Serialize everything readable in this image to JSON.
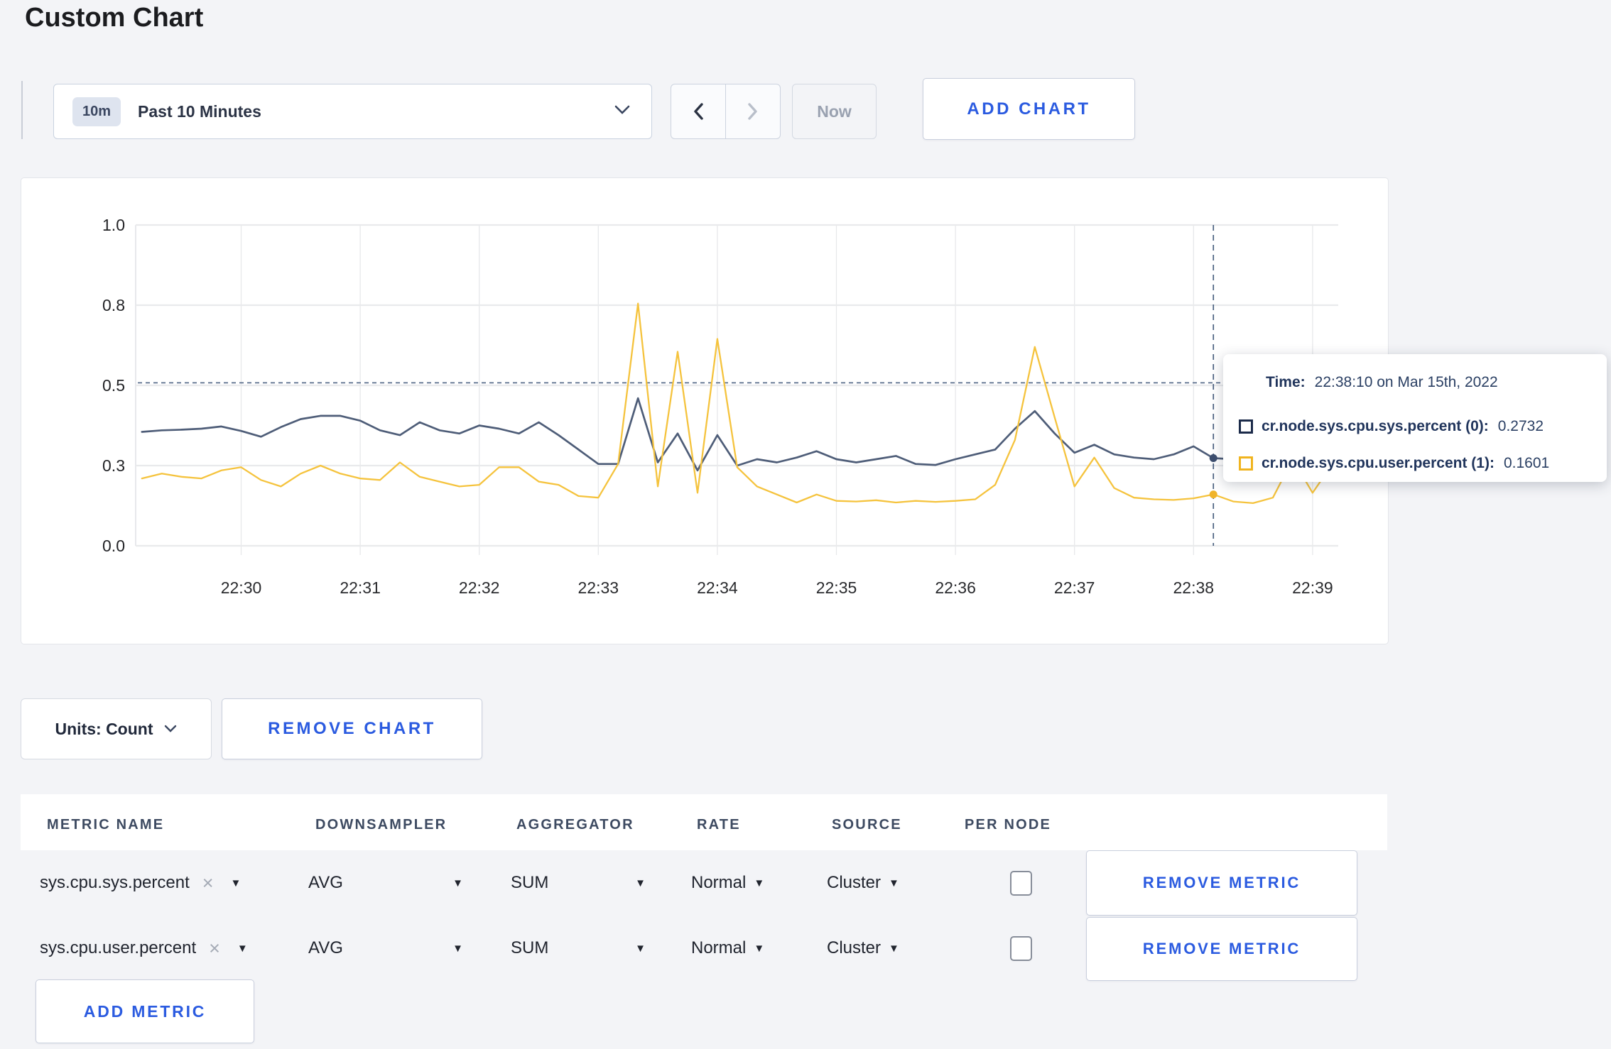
{
  "page": {
    "title": "Custom Chart"
  },
  "colors": {
    "accent_blue": "#2b5be0",
    "series_sys": "#4e5d78",
    "series_user": "#f5c33d",
    "tooltip_sys_square": "#1c2b4a",
    "tooltip_user_square": "#f0b41f"
  },
  "toolbar": {
    "time_window_badge": "10m",
    "time_window_label": "Past 10 Minutes",
    "now_label": "Now",
    "add_chart_label": "ADD CHART"
  },
  "chart_controls": {
    "units_label": "Units: Count",
    "remove_chart_label": "REMOVE CHART"
  },
  "tooltip": {
    "time_label": "Time:",
    "time_value": "22:38:10 on Mar 15th, 2022",
    "rows": [
      {
        "name": "cr.node.sys.cpu.sys.percent (0):",
        "value": "0.2732"
      },
      {
        "name": "cr.node.sys.cpu.user.percent (1):",
        "value": "0.1601"
      }
    ]
  },
  "chart_data": {
    "type": "line",
    "title": "",
    "xlabel": "",
    "ylabel": "",
    "grid": true,
    "legend_position": "tooltip",
    "ylim": [
      0,
      1.0
    ],
    "y_tick_labels": [
      "0.0",
      "0.3",
      "0.5",
      "0.8",
      "1.0"
    ],
    "y_tick_values": [
      0,
      0.25,
      0.5,
      0.75,
      1.0
    ],
    "x_tick_labels": [
      "22:30",
      "22:31",
      "22:32",
      "22:33",
      "22:34",
      "22:35",
      "22:36",
      "22:37",
      "22:38",
      "22:39"
    ],
    "x_start": "22:29:10",
    "x_interval_seconds": 10,
    "guide_hline_value": 0.508,
    "crosshair": {
      "time": "22:38:10",
      "index": 54,
      "sys_value": 0.2732,
      "user_value": 0.1601
    },
    "series": [
      {
        "name": "cr.node.sys.cpu.sys.percent (0)",
        "color": "#4e5d78",
        "values": [
          0.355,
          0.36,
          0.362,
          0.365,
          0.372,
          0.358,
          0.34,
          0.37,
          0.395,
          0.405,
          0.405,
          0.39,
          0.36,
          0.345,
          0.385,
          0.36,
          0.35,
          0.375,
          0.365,
          0.35,
          0.385,
          0.345,
          0.3,
          0.255,
          0.255,
          0.46,
          0.26,
          0.35,
          0.235,
          0.345,
          0.25,
          0.27,
          0.26,
          0.275,
          0.295,
          0.27,
          0.26,
          0.27,
          0.28,
          0.255,
          0.252,
          0.27,
          0.285,
          0.3,
          0.365,
          0.42,
          0.35,
          0.29,
          0.315,
          0.285,
          0.275,
          0.27,
          0.285,
          0.31,
          0.2732,
          0.27,
          0.285,
          0.295,
          0.28,
          0.29,
          0.305
        ]
      },
      {
        "name": "cr.node.sys.cpu.user.percent (1)",
        "color": "#f5c33d",
        "values": [
          0.21,
          0.225,
          0.215,
          0.21,
          0.235,
          0.245,
          0.205,
          0.185,
          0.225,
          0.25,
          0.225,
          0.21,
          0.205,
          0.26,
          0.215,
          0.2,
          0.185,
          0.19,
          0.245,
          0.245,
          0.2,
          0.19,
          0.155,
          0.15,
          0.255,
          0.755,
          0.185,
          0.605,
          0.165,
          0.645,
          0.245,
          0.185,
          0.16,
          0.135,
          0.16,
          0.14,
          0.138,
          0.142,
          0.135,
          0.14,
          0.137,
          0.14,
          0.145,
          0.19,
          0.33,
          0.62,
          0.4,
          0.185,
          0.275,
          0.18,
          0.15,
          0.145,
          0.143,
          0.148,
          0.1601,
          0.138,
          0.133,
          0.15,
          0.27,
          0.165,
          0.255
        ]
      }
    ]
  },
  "metrics_table": {
    "headers": [
      "METRIC NAME",
      "DOWNSAMPLER",
      "AGGREGATOR",
      "RATE",
      "SOURCE",
      "PER NODE"
    ],
    "rows": [
      {
        "metric": "sys.cpu.sys.percent",
        "remove_icon": "×",
        "downsampler": "AVG",
        "aggregator": "SUM",
        "rate": "Normal",
        "source": "Cluster",
        "per_node_checked": false,
        "remove_label": "REMOVE METRIC"
      },
      {
        "metric": "sys.cpu.user.percent",
        "remove_icon": "×",
        "downsampler": "AVG",
        "aggregator": "SUM",
        "rate": "Normal",
        "source": "Cluster",
        "per_node_checked": false,
        "remove_label": "REMOVE METRIC"
      }
    ],
    "add_metric_label": "ADD METRIC"
  }
}
